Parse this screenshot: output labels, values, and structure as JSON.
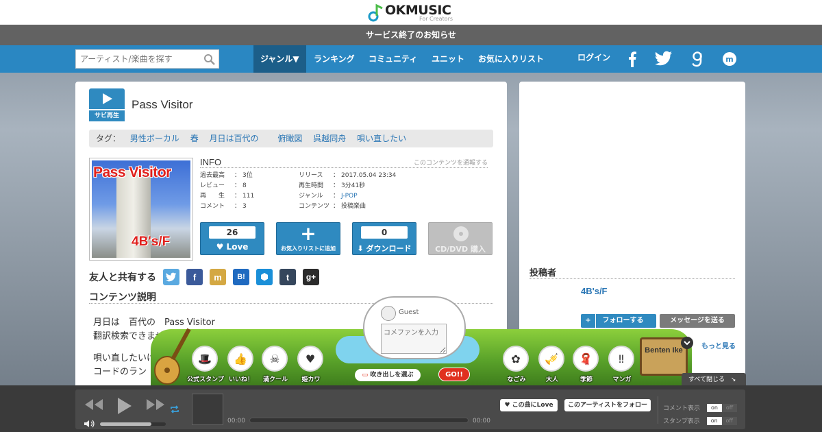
{
  "header": {
    "logo_text": "OKMUSIC",
    "logo_sub": "For Creators",
    "notice": "サービス終了のお知らせ"
  },
  "nav": {
    "search_placeholder": "アーティスト/楽曲を探す",
    "items": [
      "ジャンル▼",
      "ランキング",
      "コミュニティ",
      "ユニット",
      "お気に入りリスト"
    ],
    "login": "ログイン"
  },
  "song": {
    "sabi_label": "サビ再生",
    "title": "Pass Visitor",
    "tags_label": "タグ：",
    "tags": [
      "男性ボーカル",
      "春",
      "月日は百代の",
      "俯瞰図",
      "呉越同舟",
      "唄い直したい"
    ],
    "jacket_title": "Pass Visitor",
    "jacket_artist": "4B's/F"
  },
  "info": {
    "title": "INFO",
    "report": "このコンテンツを通報する",
    "left": [
      {
        "k": "過去最高",
        "v": "3位"
      },
      {
        "k": "レビュー",
        "v": "8"
      },
      {
        "k": "再　　生",
        "v": "111"
      },
      {
        "k": "コメント",
        "v": "3"
      }
    ],
    "right": [
      {
        "k": "リリース",
        "v": "2017.05.04 23:34"
      },
      {
        "k": "再生時間",
        "v": "3分41秒"
      },
      {
        "k": "ジャンル",
        "v": "J-POP"
      },
      {
        "k": "コンテンツ",
        "v": "投稿楽曲"
      }
    ]
  },
  "actions": {
    "love_count": "26",
    "love_label": "Love",
    "fav_label": "お気入りリストに追加",
    "dl_count": "0",
    "dl_label": "ダウンロード",
    "cd_label": "CD/DVD 購入"
  },
  "share": {
    "label": "友人と共有する",
    "services": [
      "twitter-icon",
      "facebook-icon",
      "mixi-icon",
      "hatena-icon",
      "hexagon-icon",
      "tumblr-icon",
      "google-plus-icon"
    ]
  },
  "description": {
    "title": "コンテンツ説明",
    "lines": [
      "月日は　百代の　Pass Visitor",
      "翻訳検索できません",
      "唄い直したいけど",
      "コードのラン"
    ]
  },
  "poster": {
    "title": "投稿者",
    "name": "4B's/F",
    "follow": "フォローする",
    "message": "メッセージを送る",
    "more": "もっと見る"
  },
  "stamps": {
    "guest": "Guest",
    "comment_placeholder": "コメファンを入力",
    "pick": "吹き出しを選ぶ",
    "go": "GO!!",
    "items": [
      "公式スタンプ",
      "いいね！",
      "満クール",
      "姫カワ",
      "なごみ",
      "大人",
      "季節",
      "マンガ"
    ],
    "sign": "Benten Ike",
    "close_all": "すべて閉じる"
  },
  "player": {
    "time_start": "00:00",
    "time_end": "00:00",
    "love_btn": "この曲にLove",
    "follow_btn": "このアーティストをフォロー",
    "comment_toggle": "コメント表示",
    "stamp_toggle": "スタンプ表示",
    "on": "on",
    "off": "off"
  },
  "colors": {
    "nav_blue": "#2a87c2",
    "accent_blue": "#2f8ac0",
    "link_blue": "#2a76b5",
    "notice_gray": "#626262"
  }
}
